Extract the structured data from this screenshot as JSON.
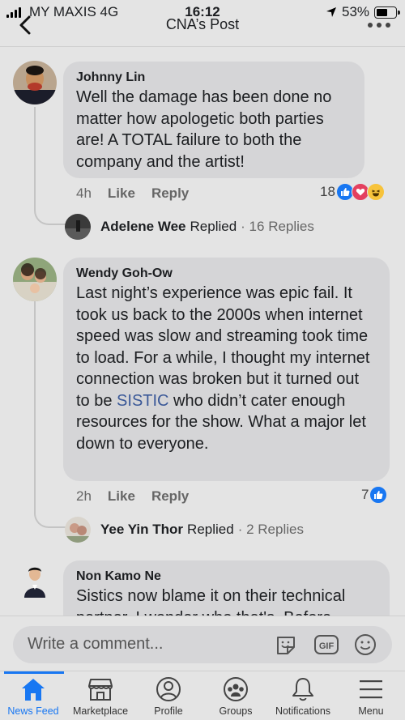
{
  "status_bar": {
    "carrier": "MY MAXIS  4G",
    "time": "16:12",
    "battery": "53%",
    "battery_level": 0.53
  },
  "header": {
    "title": "CNA’s Post"
  },
  "comments": [
    {
      "author": "Johnny Lin",
      "text": "Well the damage has been done no matter how apologetic both parties are! A TOTAL failure to both the company and the artist!",
      "time": "4h",
      "like": "Like",
      "reply": "Reply",
      "reaction_count": "18",
      "reactions": [
        "like-icon",
        "love-icon",
        "haha-icon"
      ],
      "reply_summary": {
        "name": "Adelene Wee",
        "verb": "Replied",
        "count": "· 16 Replies"
      }
    },
    {
      "author": "Wendy Goh-Ow",
      "text_before": "Last night’s experience was epic fail. It took us back to the 2000s when internet speed was slow and streaming took time to load. For a while, I thought my internet connection was broken but it turned out to be ",
      "text_link": "SISTIC",
      "text_after": " who didn’t cater enough resources for the show. What a major let down to everyone.",
      "time": "2h",
      "like": "Like",
      "reply": "Reply",
      "reaction_count": "7",
      "reactions": [
        "like-icon"
      ],
      "reply_summary": {
        "name": "Yee Yin Thor",
        "verb": "Replied",
        "count": "· 2 Replies"
      }
    },
    {
      "author": "Non Kamo Ne",
      "text": "Sistics now blame it on their technical partner. I wonder who that's. Before"
    }
  ],
  "composer": {
    "placeholder": "Write a comment..."
  },
  "tabs": [
    {
      "label": "News Feed",
      "icon": "home-icon",
      "active": true
    },
    {
      "label": "Marketplace",
      "icon": "store-icon",
      "active": false
    },
    {
      "label": "Profile",
      "icon": "profile-icon",
      "active": false
    },
    {
      "label": "Groups",
      "icon": "groups-icon",
      "active": false
    },
    {
      "label": "Notifications",
      "icon": "bell-icon",
      "active": false
    },
    {
      "label": "Menu",
      "icon": "menu-icon",
      "active": false
    }
  ],
  "colors": {
    "accent": "#1877f2",
    "link": "#3b5998",
    "bubble": "#d5d5d7",
    "background": "#e4e4e4"
  }
}
